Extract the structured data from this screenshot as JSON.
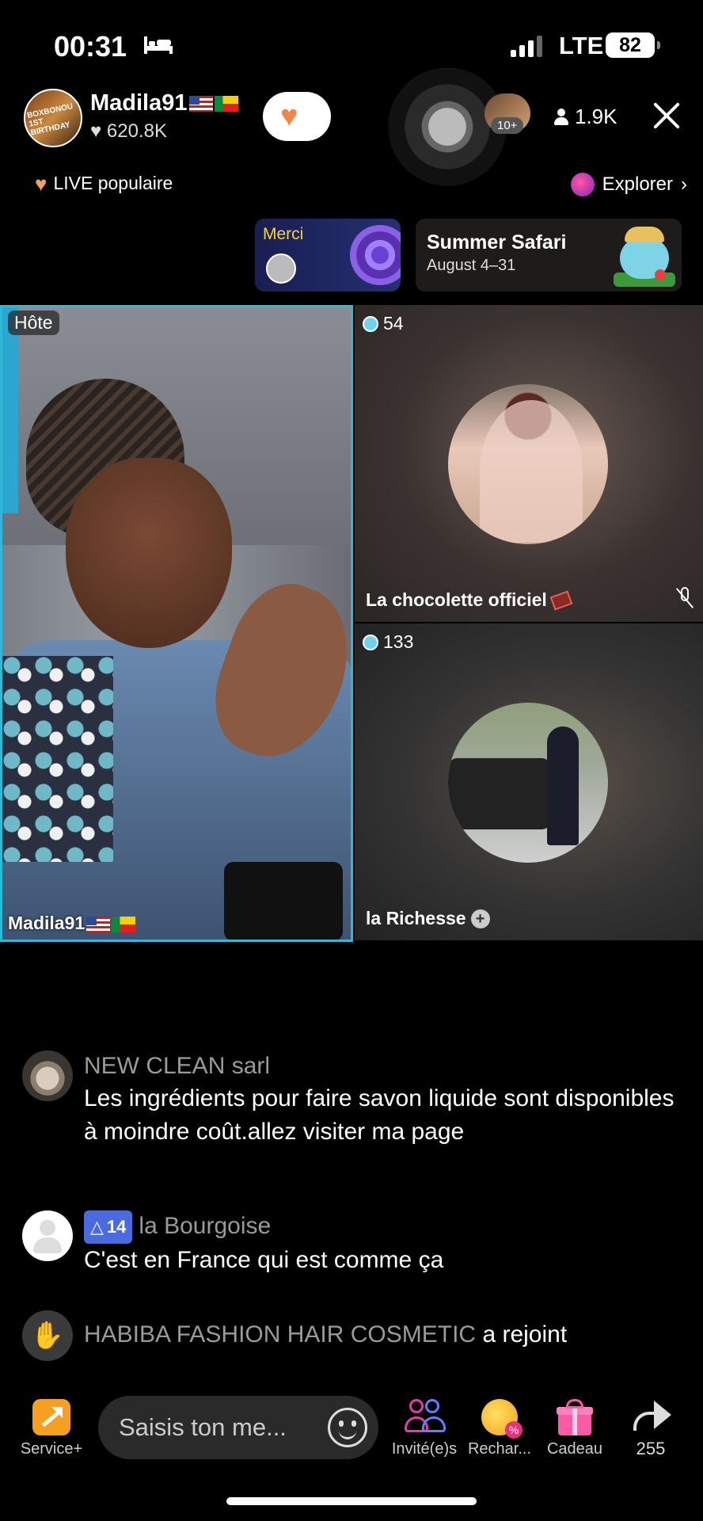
{
  "status_bar": {
    "time": "00:31",
    "network": "LTE",
    "battery": "82"
  },
  "host": {
    "name": "Madila91",
    "likes": "620.8K",
    "avatar_text": "BOXBONOU 1ST BIRTHDAY"
  },
  "viewers": {
    "avatar_badge": "10+",
    "count": "1.9K"
  },
  "live_popular": "LIVE populaire",
  "explorer": "Explorer",
  "banners": {
    "merci": "Merci",
    "safari_title": "Summer Safari",
    "safari_dates": "August 4–31"
  },
  "host_tile": {
    "tag": "Hôte",
    "name": "Madila91"
  },
  "guests": [
    {
      "count": "54",
      "name": "La chocolette officiel"
    },
    {
      "count": "133",
      "name": "la Richesse"
    }
  ],
  "chat": [
    {
      "user": "NEW CLEAN sarl",
      "message": "Les ingrédients pour faire savon liquide sont disponibles à moindre coût.allez visiter ma page"
    },
    {
      "badge": "14",
      "user": "la Bourgoise",
      "message": "C'est en France qui est comme ça"
    },
    {
      "user": "HABIBA FASHION HAIR COSMETIC",
      "message": "a rejoint"
    }
  ],
  "bottom_bar": {
    "service": "Service+",
    "input_placeholder": "Saisis ton me...",
    "invite": "Invité(e)s",
    "recharge": "Rechar...",
    "gift": "Cadeau",
    "share_count": "255"
  },
  "colors": {
    "accent_host_border": "#2fb8d8",
    "merci_text": "#f5d33a",
    "level_badge": "#4a6ae0"
  }
}
